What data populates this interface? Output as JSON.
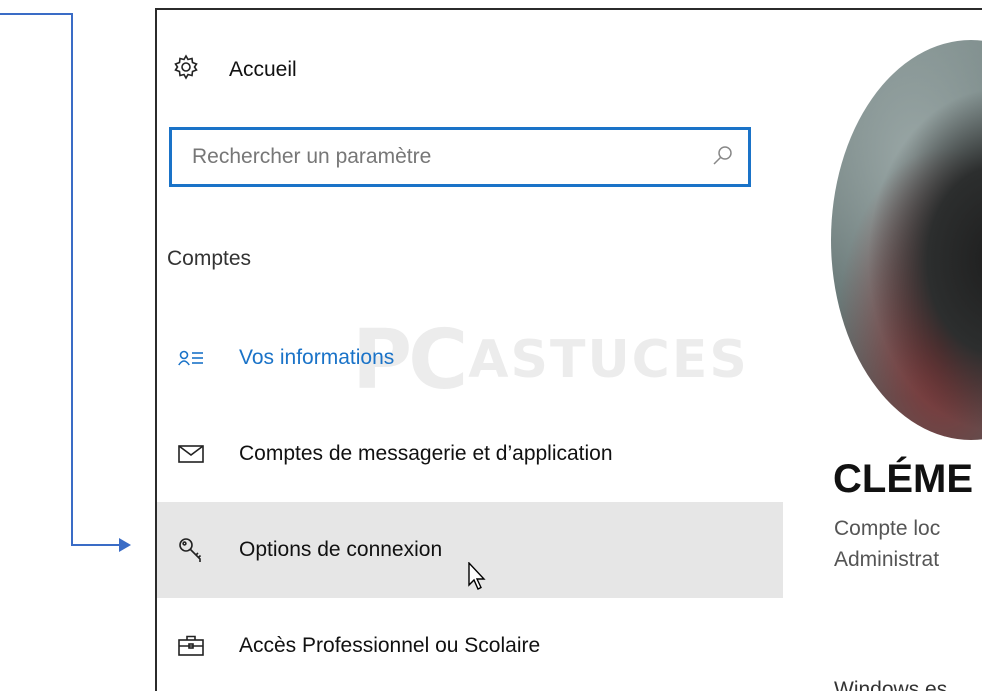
{
  "header": {
    "home_label": "Accueil",
    "home_icon": "gear-icon"
  },
  "search": {
    "placeholder": "Rechercher un paramètre",
    "icon": "search-icon"
  },
  "section": {
    "label": "Comptes"
  },
  "nav": {
    "items": [
      {
        "label": "Vos informations",
        "icon": "person-list-icon",
        "state": "active"
      },
      {
        "label": "Comptes de messagerie et d’application",
        "icon": "mail-icon",
        "state": "normal"
      },
      {
        "label": "Options de connexion",
        "icon": "key-icon",
        "state": "hover"
      },
      {
        "label": "Accès Professionnel ou Scolaire",
        "icon": "briefcase-icon",
        "state": "normal"
      }
    ]
  },
  "watermark": {
    "part1": "PC",
    "part2": "ASTUCES"
  },
  "user": {
    "name": "CLÉME",
    "account_type": "Compte loc",
    "role": "Administrat",
    "footer": "Windows es"
  },
  "colors": {
    "accent": "#1a73c8",
    "hover_bg": "#e6e6e6",
    "arrow": "#3a6cc6"
  }
}
